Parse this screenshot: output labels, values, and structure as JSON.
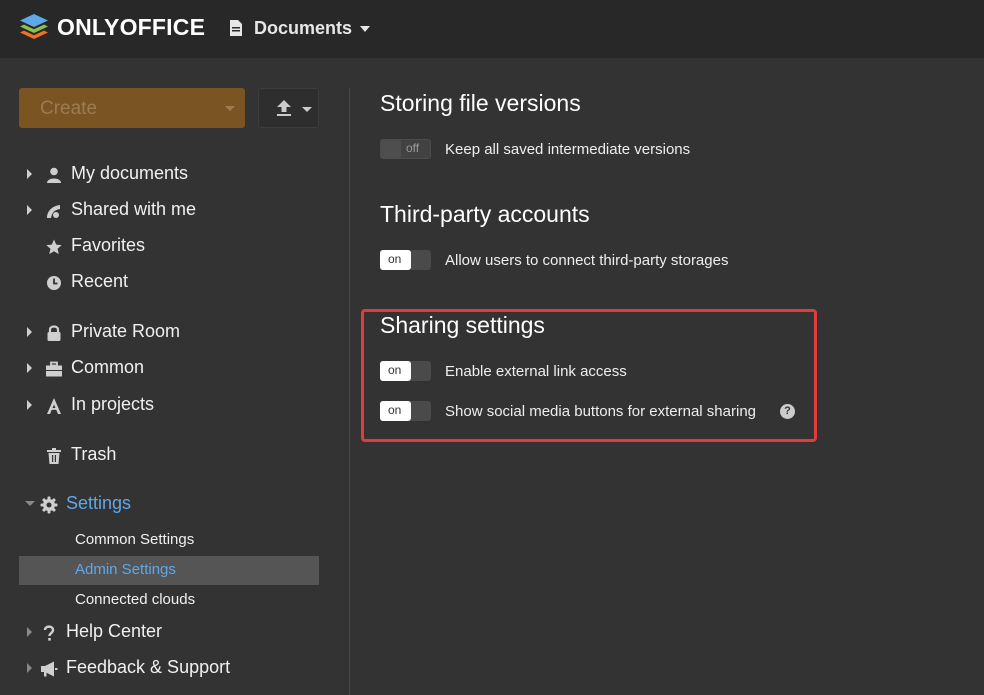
{
  "topbar": {
    "brand": "ONLYOFFICE",
    "module": "Documents",
    "colors": {
      "bg": "#282828",
      "logo_top": "#5fa8e8",
      "logo_mid": "#8bc34a",
      "logo_bot": "#f36f21"
    }
  },
  "sidebar": {
    "create_label": "Create",
    "upload_icon": "upload-icon",
    "items": [
      {
        "label": "My documents",
        "icon": "person-icon"
      },
      {
        "label": "Shared with me",
        "icon": "share-icon"
      },
      {
        "label": "Favorites",
        "icon": "star-icon"
      },
      {
        "label": "Recent",
        "icon": "clock-icon"
      },
      {
        "label": "Private Room",
        "icon": "lock-icon"
      },
      {
        "label": "Common",
        "icon": "briefcase-icon"
      },
      {
        "label": "In projects",
        "icon": "projects-icon"
      },
      {
        "label": "Trash",
        "icon": "trash-icon"
      },
      {
        "label": "Settings",
        "icon": "gear-icon"
      },
      {
        "label": "Help Center",
        "icon": "question-icon"
      },
      {
        "label": "Feedback & Support",
        "icon": "megaphone-icon"
      }
    ],
    "settings_sub": [
      {
        "label": "Common Settings"
      },
      {
        "label": "Admin Settings",
        "active": true
      },
      {
        "label": "Connected clouds"
      }
    ]
  },
  "main": {
    "sections": [
      {
        "title": "Storing file versions",
        "options": [
          {
            "toggle": "off",
            "label": "Keep all saved intermediate versions"
          }
        ]
      },
      {
        "title": "Third-party accounts",
        "options": [
          {
            "toggle": "on",
            "label": "Allow users to connect third-party storages"
          }
        ]
      },
      {
        "title": "Sharing settings",
        "options": [
          {
            "toggle": "on",
            "label": "Enable external link access"
          },
          {
            "toggle": "on",
            "label": "Show social media buttons for external sharing",
            "help": true
          }
        ]
      }
    ],
    "accent_color": "#5fa8e8",
    "highlight_color": "#e03c3c"
  }
}
